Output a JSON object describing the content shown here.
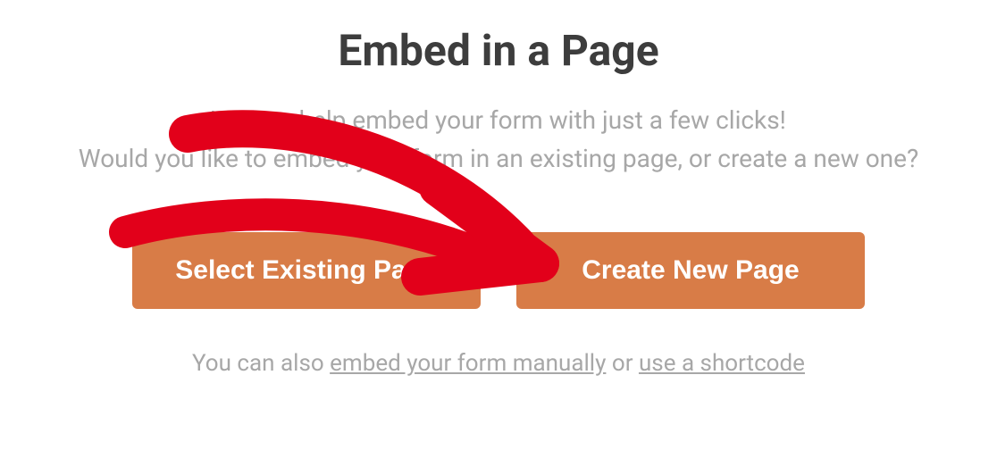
{
  "dialog": {
    "title": "Embed in a Page",
    "subtitle_line1": "We can help embed your form with just a few clicks!",
    "subtitle_line2": "Would you like to embed your form in an existing page, or create a new one?",
    "buttons": {
      "select_existing": "Select Existing Page",
      "create_new": "Create New Page"
    },
    "footer": {
      "prefix": "You can also ",
      "link_manual": "embed your form manually",
      "middle": " or ",
      "link_shortcode": "use a shortcode"
    }
  },
  "annotation": {
    "type": "hand-drawn-arrow",
    "color": "#e2001a",
    "target": "create-new-page-button"
  }
}
